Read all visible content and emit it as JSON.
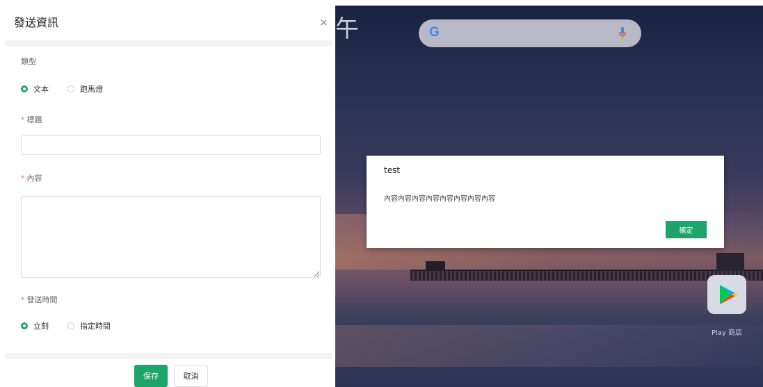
{
  "dialog": {
    "title": "發送資訊",
    "close": "×",
    "type_label": "類型",
    "type_options": [
      "文本",
      "跑馬燈"
    ],
    "type_selected": "文本",
    "title_label": "標題",
    "title_value": "",
    "content_label": "內容",
    "content_value": "",
    "required_mark": "*",
    "time_label": "發送時間",
    "time_options": [
      "立刻",
      "指定時間"
    ],
    "time_selected": "立刻",
    "save_label": "保存",
    "cancel_label": "取消"
  },
  "preview": {
    "clock_fragment": "午",
    "search_logo": "G",
    "modal": {
      "title": "test",
      "body": "內容內容內容內容內容內容內容內容",
      "ok_label": "確定"
    },
    "play_store_label": "Play 商店"
  },
  "colors": {
    "accent": "#1ca46b",
    "required": "#f56c6c"
  }
}
